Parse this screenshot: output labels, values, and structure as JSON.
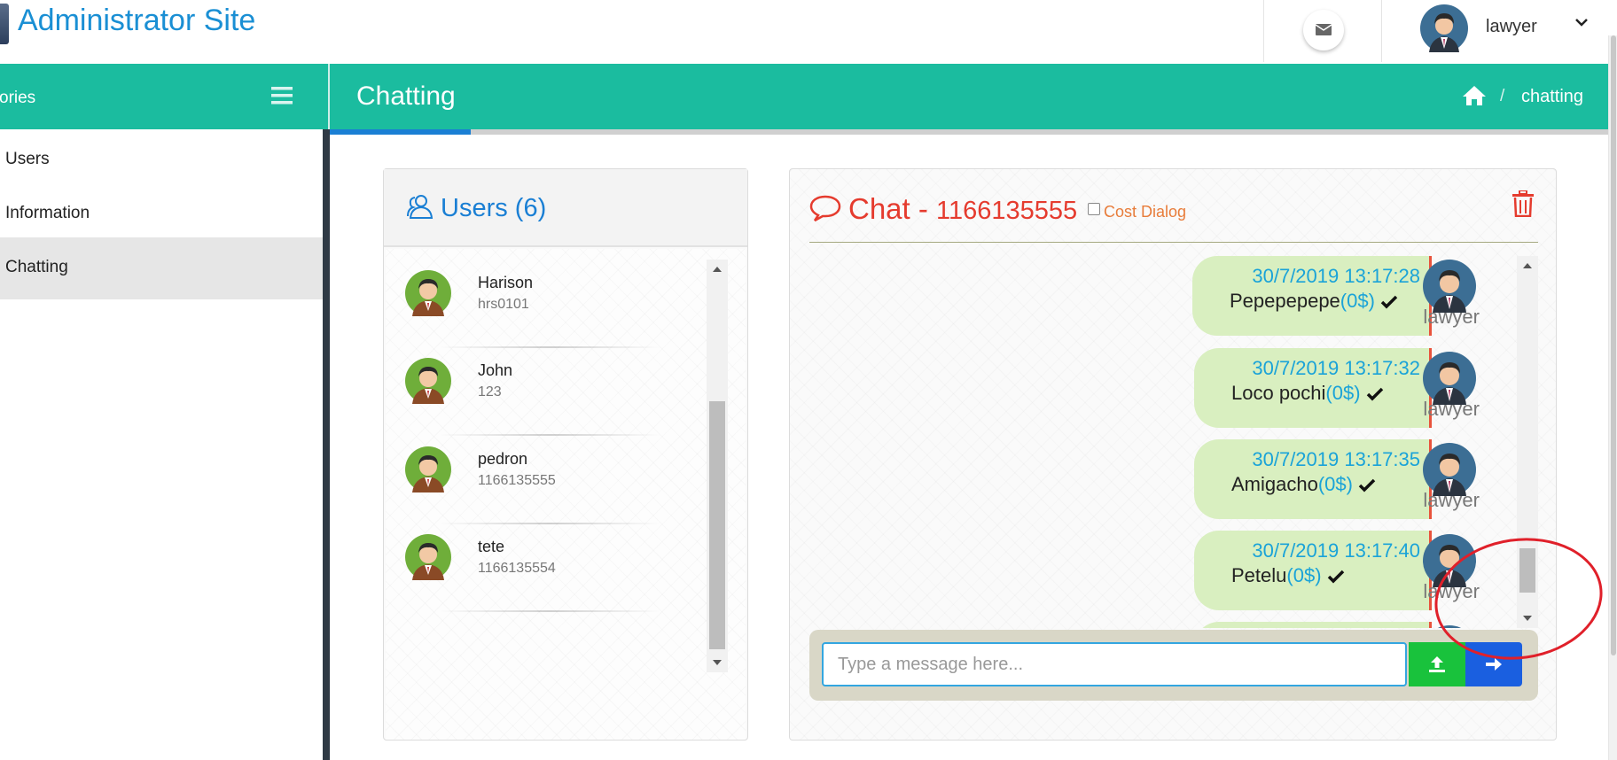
{
  "header": {
    "site_title": "Administrator Site",
    "user_name": "lawyer",
    "icons": {
      "mail": "envelope-icon",
      "dropdown": "chevron-down-icon"
    }
  },
  "sidebar": {
    "heading": "ories",
    "items": [
      {
        "label": "Users"
      },
      {
        "label": "Information"
      },
      {
        "label": "Chatting",
        "active": true
      }
    ]
  },
  "page": {
    "title": "Chatting",
    "breadcrumb": {
      "separator": "/",
      "current": "chatting"
    },
    "progress_fraction": 0.11
  },
  "users_panel": {
    "title": "Users (6)",
    "users": [
      {
        "name": "Harison",
        "sub": "hrs0101"
      },
      {
        "name": "John",
        "sub": "123"
      },
      {
        "name": "pedron",
        "sub": "1166135555"
      },
      {
        "name": "tete",
        "sub": "1166135554"
      }
    ]
  },
  "chat": {
    "title_prefix": "Chat -",
    "number": "1166135555",
    "cost_dialog_label": "Cost Dialog",
    "messages": [
      {
        "time": "30/7/2019 13:17:28",
        "text": "Pepepepepe",
        "cost": "(0$)",
        "author": "lawyer"
      },
      {
        "time": "30/7/2019 13:17:32",
        "text": "Loco pochi",
        "cost": "(0$)",
        "author": "lawyer"
      },
      {
        "time": "30/7/2019 13:17:35",
        "text": "Amigacho",
        "cost": "(0$)",
        "author": "lawyer"
      },
      {
        "time": "30/7/2019 13:17:40",
        "text": "Petelu",
        "cost": "(0$)",
        "author": "lawyer"
      }
    ],
    "input_placeholder": "Type a message here..."
  },
  "colors": {
    "teal": "#1bbc9f",
    "link_blue": "#1a7fd4",
    "chat_red": "#e53b2e",
    "bubble_green": "#d9efc0",
    "upload_green": "#19c23c",
    "send_blue": "#1a5fe0",
    "annotation_red": "#e0202a"
  }
}
